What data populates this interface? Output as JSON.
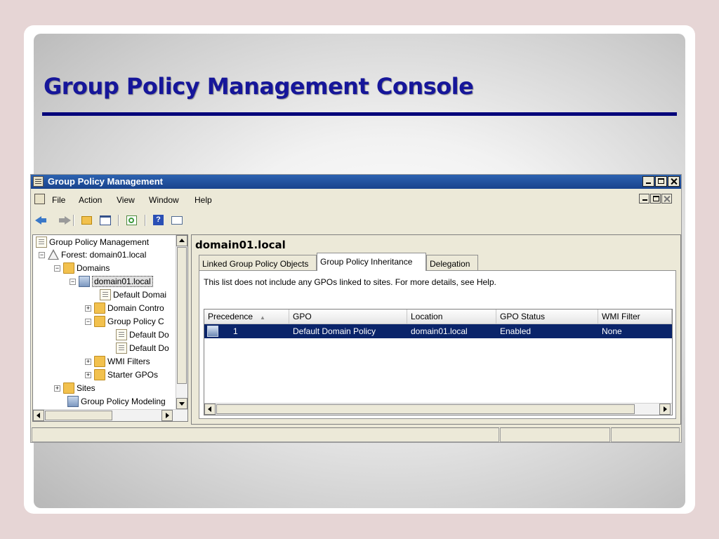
{
  "slide": {
    "title": "Group Policy Management Console"
  },
  "window": {
    "title": "Group Policy Management"
  },
  "menu": {
    "items": [
      "File",
      "Action",
      "View",
      "Window",
      "Help"
    ]
  },
  "toolbar": {
    "icons": [
      "back-arrow-icon",
      "forward-arrow-icon",
      "up-folder-icon",
      "show-hide-tree-icon",
      "refresh-icon",
      "help-icon",
      "action-pane-icon"
    ]
  },
  "tree": {
    "root": "Group Policy Management",
    "forest": "Forest: domain01.local",
    "domains": "Domains",
    "domain": "domain01.local",
    "default_domain": "Default Domai",
    "domain_controllers": "Domain Contro",
    "gpo_container": "Group Policy C",
    "gpo_1": "Default Do",
    "gpo_2": "Default Do",
    "wmi_filters": "WMI Filters",
    "starter_gpos": "Starter GPOs",
    "sites": "Sites",
    "modeling": "Group Policy Modeling"
  },
  "content": {
    "title": "domain01.local",
    "tabs": [
      "Linked Group Policy Objects",
      "Group Policy Inheritance",
      "Delegation"
    ],
    "active_tab": "Group Policy Inheritance",
    "info": "This list does not include any GPOs linked to sites. For more details, see Help.",
    "columns": [
      "Precedence",
      "GPO",
      "Location",
      "GPO Status",
      "WMI Filter"
    ],
    "rows": [
      {
        "precedence": "1",
        "gpo": "Default Domain Policy",
        "location": "domain01.local",
        "status": "Enabled",
        "wmi": "None"
      }
    ]
  },
  "colors": {
    "title_text": "#16169a",
    "title_rule": "#00007a",
    "titlebar": "#1f4e9a",
    "selection": "#0a246a"
  }
}
